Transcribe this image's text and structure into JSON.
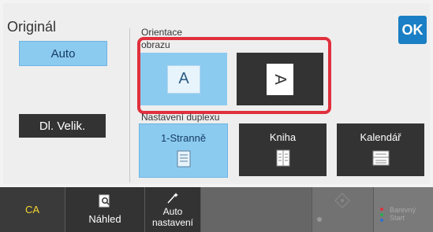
{
  "left": {
    "title": "Originál",
    "auto_label": "Auto",
    "size_label": "Dl. Velik."
  },
  "ok_label": "OK",
  "orientation": {
    "label_line1": "Orientace",
    "label_line2": "obrazu",
    "portrait_glyph": "A",
    "landscape_glyph": "A"
  },
  "duplex": {
    "label": "Nastavení duplexu",
    "options": [
      "1-Stranně",
      "Kniha",
      "Kalendář"
    ]
  },
  "bottom": {
    "ca_label": "CA",
    "preview_label": "Náhled",
    "auto_settings_line1": "Auto",
    "auto_settings_line2": "nastavení",
    "bw_start_line1": "",
    "color_start_line1": "Barevný",
    "color_start_line2": "Start"
  },
  "colors": {
    "accent": "#1a7fc4",
    "highlight": "#e0303d",
    "selected_fill": "#8ccbf0",
    "dark_fill": "#333333"
  }
}
